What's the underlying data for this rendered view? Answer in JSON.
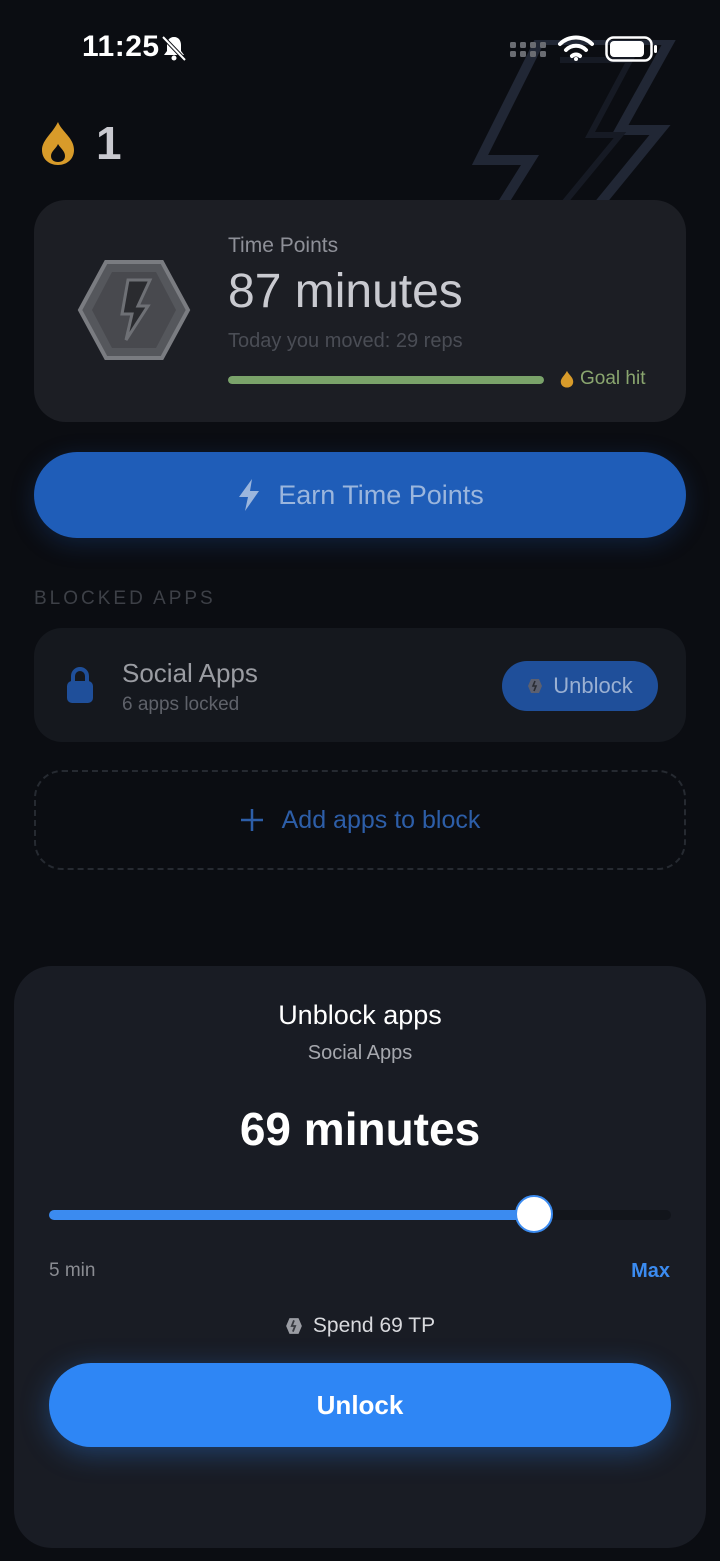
{
  "status_bar": {
    "time": "11:25"
  },
  "streak": {
    "count": "1"
  },
  "points_card": {
    "label": "Time Points",
    "value": "87 minutes",
    "today": "Today you moved: 29 reps",
    "progress": 1.0,
    "goal_label": "Goal hit"
  },
  "earn_button": {
    "label": "Earn Time Points"
  },
  "blocked_section": {
    "title": "BLOCKED APPS",
    "items": [
      {
        "name": "Social Apps",
        "subtitle": "6 apps locked",
        "action": "Unblock"
      }
    ],
    "add_label": "Add apps to block"
  },
  "sheet": {
    "title": "Unblock apps",
    "subtitle": "Social Apps",
    "value": "69 minutes",
    "slider": {
      "level": 0.78,
      "min_label": "5 min",
      "max_label": "Max"
    },
    "spend_label": "Spend 69 TP",
    "unlock_label": "Unlock"
  },
  "colors": {
    "accent": "#2e86f5",
    "goal": "#8aa66f",
    "flame": "#d89b2a"
  }
}
